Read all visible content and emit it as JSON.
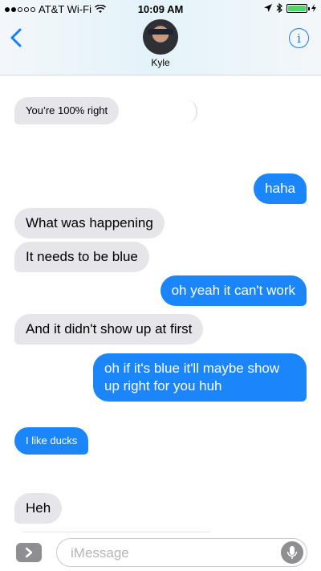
{
  "status_bar": {
    "carrier": "AT&T Wi-Fi",
    "time": "10:09 AM",
    "signal_dots": 5,
    "signal_filled": 2,
    "battery_level": 1.0,
    "battery_color": "#4cd964"
  },
  "header": {
    "back_icon": "chevron-left-icon",
    "contact_name": "Kyle",
    "info_icon_label": "i"
  },
  "messages": [
    {
      "from": "them",
      "text": "You’re 100% right"
    },
    {
      "from": "me",
      "text": "haha"
    },
    {
      "from": "them",
      "text": "What was happening"
    },
    {
      "from": "them",
      "text": "It needs to be blue"
    },
    {
      "from": "me",
      "text": "oh yeah it can't work"
    },
    {
      "from": "them",
      "text": "And it didn't show up at first"
    },
    {
      "from": "me",
      "text": "oh if it's blue it'll maybe show up right for you huh"
    },
    {
      "from": "me",
      "text": "I like ducks"
    },
    {
      "from": "them",
      "text": "Heh"
    }
  ],
  "input": {
    "placeholder": "iMessage",
    "apps_icon": "chevron-right-icon",
    "mic_icon": "microphone-icon"
  },
  "colors": {
    "accent": "#147efb",
    "outgoing_bubble": "#1b86fa",
    "incoming_bubble": "#e5e5ea"
  }
}
